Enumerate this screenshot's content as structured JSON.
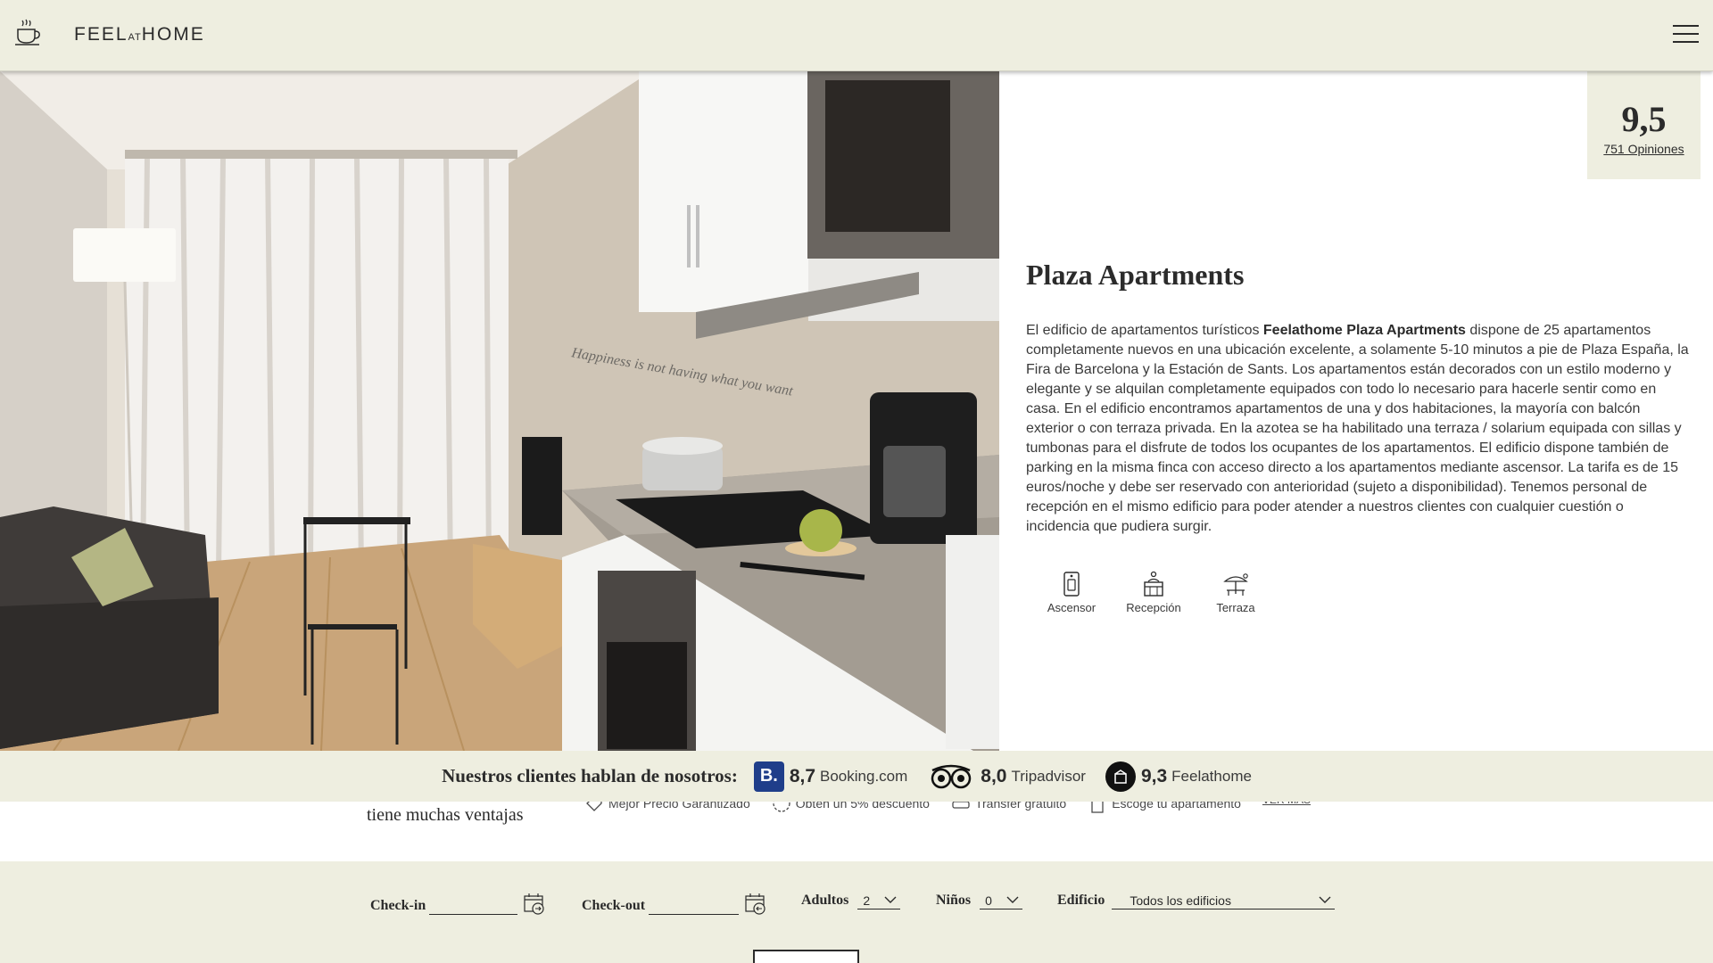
{
  "header": {
    "logo_prefix": "FEEL",
    "logo_at": "AT",
    "logo_suffix": "HOME"
  },
  "rating": {
    "score": "9,5",
    "reviews_link": "751 Opiniones"
  },
  "property": {
    "title": "Plaza Apartments",
    "desc_intro": "El edificio de apartamentos turísticos ",
    "desc_brand": "Feelathome Plaza Apartments",
    "desc_body": " dispone de 25 apartamentos completamente nuevos en una ubicación excelente, a solamente 5-10 minutos a pie de Plaza España, la Fira de Barcelona y la Estación de Sants. Los apartamentos están decorados con un estilo moderno y elegante y se alquilan completamente equipados con todo lo necesario para hacerle sentir como en casa. En el edificio encontramos apartamentos de una y dos habitaciones, la mayoría con balcón exterior o con terraza privada. En la azotea se ha habilitado una terraza / solarium equipada con sillas y tumbonas para el disfrute de todos los ocupantes de los apartamentos. El edificio dispone también de parking en la misma finca con acceso directo a los apartamentos mediante ascensor. La tarifa es de 15 euros/noche y debe ser reservado con anterioridad (sujeto a disponibilidad). Tenemos personal de recepción en el mismo edificio para poder atender a nuestros clientes con cualquier cuestión o incidencia que pudiera surgir."
  },
  "amenities": [
    {
      "label": "Ascensor",
      "icon": "elevator-icon"
    },
    {
      "label": "Recepción",
      "icon": "reception-icon"
    },
    {
      "label": "Terraza",
      "icon": "terrace-icon"
    }
  ],
  "reviews": {
    "title": "Nuestros clientes hablan de nosotros:",
    "booking": {
      "badge": "B.",
      "score": "8,7",
      "name": "Booking.com"
    },
    "tripadvisor": {
      "score": "8,0",
      "name": "Tripadvisor"
    },
    "feelathome": {
      "score": "9,3",
      "name": "Feelathome"
    }
  },
  "advantages": {
    "title": "tiene muchas ventajas",
    "items": [
      "Mejor Precio Garantizado",
      "Obtén un 5% descuento",
      "Transfer gratuito",
      "Escoge tu apartamento"
    ],
    "more": "VER MÁS"
  },
  "booking": {
    "checkin_label": "Check-in",
    "checkin_value": "",
    "checkout_label": "Check-out",
    "checkout_value": "",
    "adults_label": "Adultos",
    "adults_value": "2",
    "children_label": "Niños",
    "children_value": "0",
    "building_label": "Edificio",
    "building_value": "Todos los edificios"
  },
  "colors": {
    "band_bg": "#eeeee0",
    "text": "#2b2b2b",
    "booking_blue": "#1f3e8a"
  }
}
